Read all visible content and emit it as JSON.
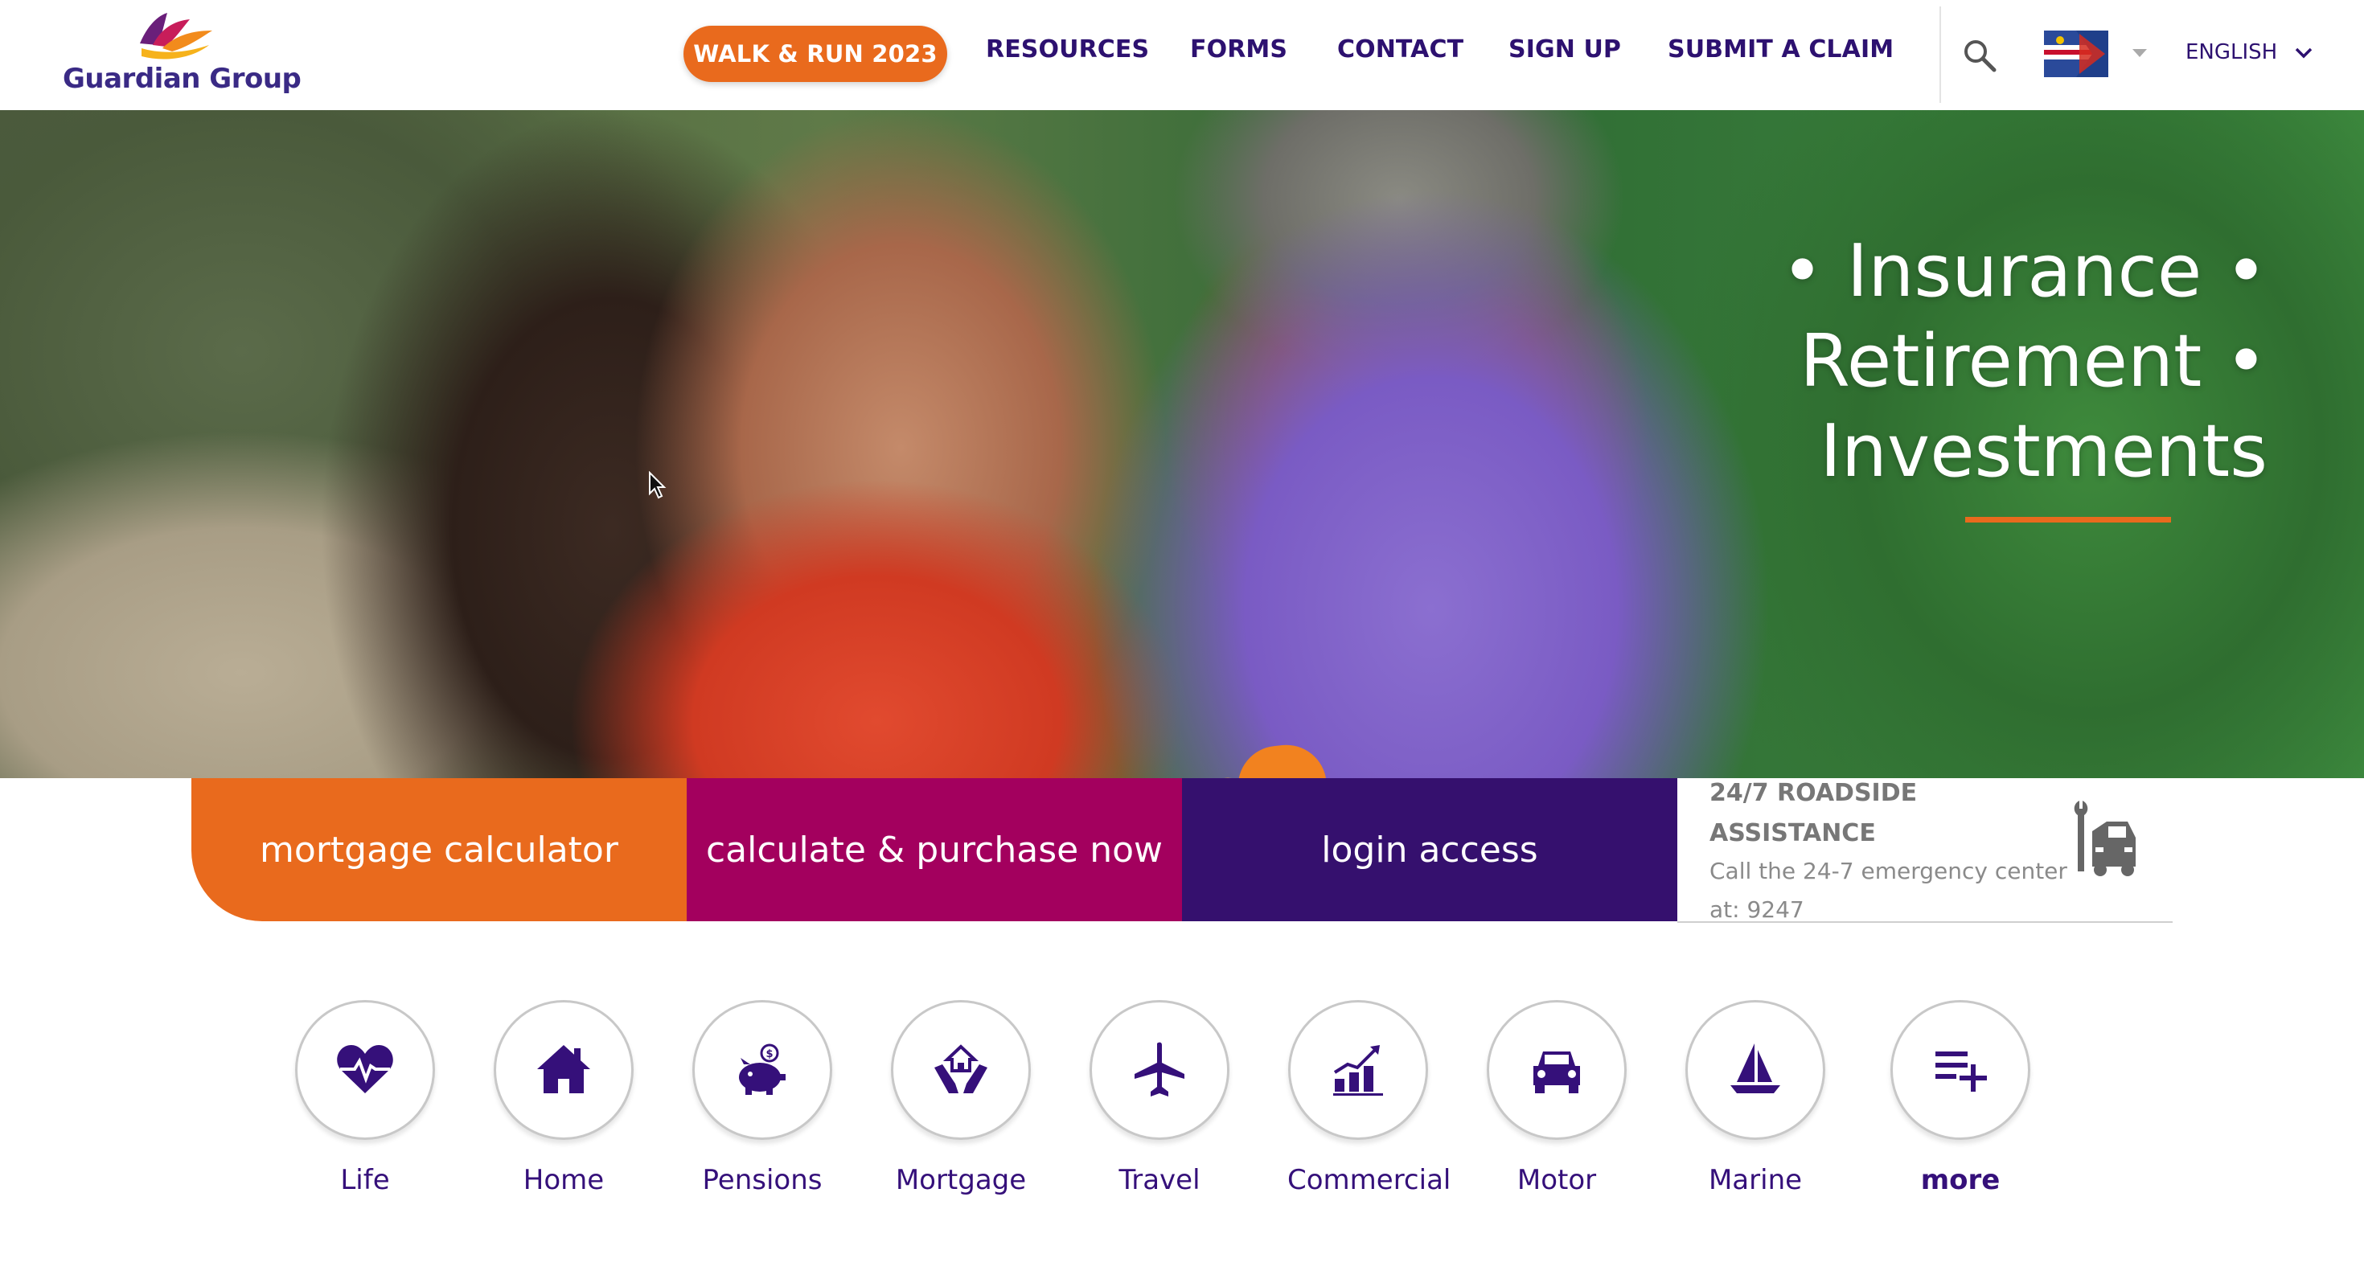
{
  "header": {
    "logo_text": "Guardian Group",
    "walk_button": "WALK & RUN 2023",
    "nav": [
      "RESOURCES",
      "FORMS",
      "CONTACT",
      "SIGN UP",
      "SUBMIT A CLAIM"
    ],
    "language": "ENGLISH",
    "icons": [
      "search-icon",
      "flag-icon",
      "chevron-down-icon"
    ]
  },
  "hero": {
    "tagline_lines": [
      "• Insurance •",
      "Retirement •",
      "Investments"
    ]
  },
  "tiles": {
    "mortgage": "mortgage calculator",
    "calculate": "calculate & purchase now",
    "login": "login access",
    "roadside_title": "24/7 ROADSIDE ASSISTANCE",
    "roadside_text": "Call the 24-7 emergency center at: 9247"
  },
  "products": [
    {
      "label": "Life",
      "icon": "heart-pulse-icon"
    },
    {
      "label": "Home",
      "icon": "home-icon"
    },
    {
      "label": "Pensions",
      "icon": "piggy-bank-icon"
    },
    {
      "label": "Mortgage",
      "icon": "hands-house-icon"
    },
    {
      "label": "Travel",
      "icon": "airplane-icon"
    },
    {
      "label": "Commercial",
      "icon": "growth-chart-icon"
    },
    {
      "label": "Motor",
      "icon": "car-icon"
    },
    {
      "label": "Marine",
      "icon": "sailboat-icon"
    },
    {
      "label": "more",
      "icon": "list-add-icon"
    }
  ],
  "colors": {
    "orange": "#e96a1d",
    "magenta": "#a3005e",
    "purple": "#35106e",
    "text_purple": "#35107a"
  }
}
